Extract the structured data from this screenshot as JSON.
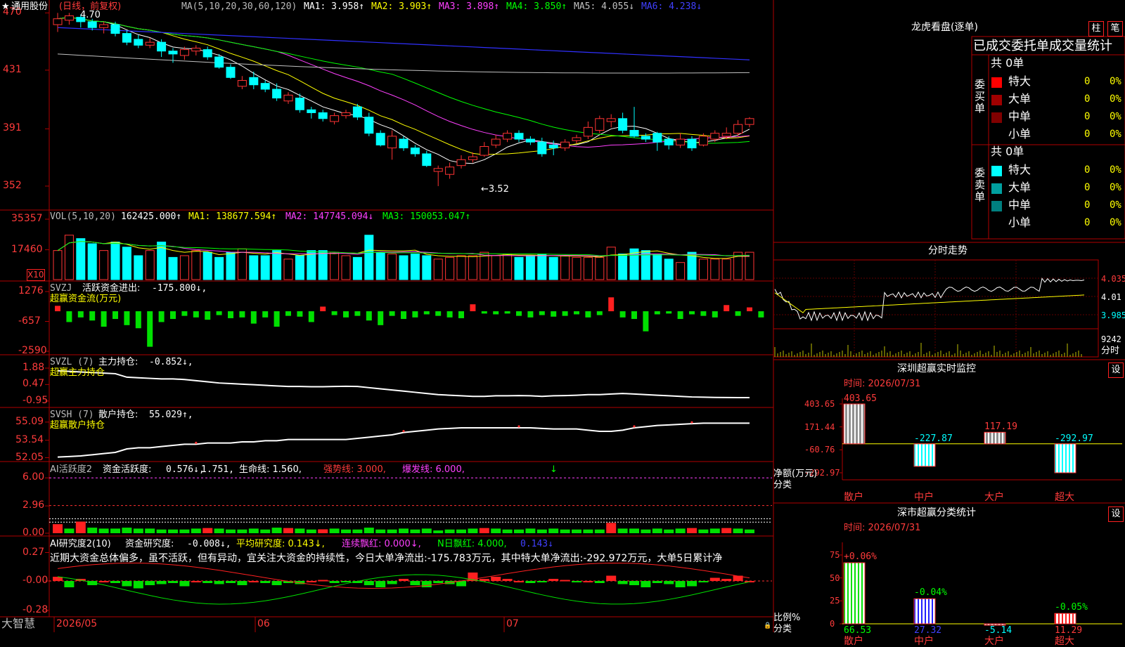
{
  "app": {
    "brand": "大智慧"
  },
  "kline": {
    "star": "★",
    "stock": "通用股份",
    "mode": "(日线，前复权)",
    "ma_head": "MA(5,10,20,30,60,120)",
    "ma": [
      {
        "label": "MA1: 3.958↑",
        "color": "#ffffff"
      },
      {
        "label": "MA2: 3.903↑",
        "color": "#ffff00"
      },
      {
        "label": "MA3: 3.898↑",
        "color": "#ff40ff"
      },
      {
        "label": "MA4: 3.850↑",
        "color": "#00ff00"
      },
      {
        "label": "MA5: 4.055↓",
        "color": "#c0c0c0"
      },
      {
        "label": "MA6: 4.238↓",
        "color": "#4040ff"
      }
    ],
    "yaxis": [
      "470",
      "431",
      "391",
      "352"
    ],
    "yrange": [
      3.4,
      4.74
    ],
    "high_label": "4.70",
    "low_label": "←3.52",
    "candles": [
      [
        4.62,
        4.66,
        4.7,
        4.57
      ],
      [
        4.65,
        4.68,
        4.7,
        4.62
      ],
      [
        4.67,
        4.64,
        4.69,
        4.6
      ],
      [
        4.64,
        4.6,
        4.66,
        4.58
      ],
      [
        4.6,
        4.62,
        4.64,
        4.56
      ],
      [
        4.62,
        4.56,
        4.64,
        4.54
      ],
      [
        4.56,
        4.5,
        4.58,
        4.48
      ],
      [
        4.52,
        4.48,
        4.55,
        4.46
      ],
      [
        4.48,
        4.5,
        4.53,
        4.46
      ],
      [
        4.5,
        4.44,
        4.52,
        4.4
      ],
      [
        4.44,
        4.42,
        4.46,
        4.36
      ],
      [
        4.41,
        4.45,
        4.47,
        4.38
      ],
      [
        4.44,
        4.46,
        4.48,
        4.41
      ],
      [
        4.45,
        4.4,
        4.47,
        4.38
      ],
      [
        4.4,
        4.33,
        4.42,
        4.32
      ],
      [
        4.33,
        4.26,
        4.35,
        4.25
      ],
      [
        4.2,
        4.24,
        4.27,
        4.18
      ],
      [
        4.26,
        4.21,
        4.3,
        4.18
      ],
      [
        4.22,
        4.18,
        4.24,
        4.16
      ],
      [
        4.18,
        4.12,
        4.22,
        4.1
      ],
      [
        4.1,
        4.14,
        4.16,
        4.08
      ],
      [
        4.12,
        4.04,
        4.15,
        4.02
      ],
      [
        4.04,
        4.02,
        4.06,
        3.98
      ],
      [
        4.02,
        3.98,
        4.04,
        3.96
      ],
      [
        3.96,
        4.0,
        4.02,
        3.94
      ],
      [
        4.0,
        4.02,
        4.04,
        3.98
      ],
      [
        4.06,
        3.99,
        4.08,
        3.97
      ],
      [
        3.99,
        3.88,
        4.02,
        3.86
      ],
      [
        3.88,
        3.8,
        3.9,
        3.79
      ],
      [
        3.78,
        3.86,
        3.9,
        3.7
      ],
      [
        3.84,
        3.78,
        3.86,
        3.76
      ],
      [
        3.78,
        3.74,
        3.8,
        3.72
      ],
      [
        3.74,
        3.66,
        3.76,
        3.65
      ],
      [
        3.62,
        3.64,
        3.66,
        3.52
      ],
      [
        3.6,
        3.65,
        3.68,
        3.57
      ],
      [
        3.66,
        3.7,
        3.73,
        3.64
      ],
      [
        3.7,
        3.72,
        3.75,
        3.68
      ],
      [
        3.73,
        3.79,
        3.82,
        3.72
      ],
      [
        3.8,
        3.84,
        3.87,
        3.78
      ],
      [
        3.84,
        3.88,
        3.9,
        3.82
      ],
      [
        3.88,
        3.84,
        3.9,
        3.82
      ],
      [
        3.84,
        3.82,
        3.86,
        3.8
      ],
      [
        3.82,
        3.74,
        3.85,
        3.72
      ],
      [
        3.8,
        3.78,
        3.83,
        3.73
      ],
      [
        3.78,
        3.82,
        3.84,
        3.76
      ],
      [
        3.83,
        3.85,
        3.87,
        3.81
      ],
      [
        3.86,
        3.92,
        3.96,
        3.84
      ],
      [
        3.9,
        3.98,
        4.0,
        3.88
      ],
      [
        3.96,
        3.98,
        4.01,
        3.92
      ],
      [
        3.98,
        3.9,
        4.02,
        3.88
      ],
      [
        3.9,
        3.86,
        4.06,
        3.85
      ],
      [
        3.86,
        3.84,
        3.88,
        3.82
      ],
      [
        3.88,
        3.82,
        3.89,
        3.76
      ],
      [
        3.84,
        3.8,
        3.86,
        3.77
      ],
      [
        3.8,
        3.84,
        3.88,
        3.78
      ],
      [
        3.84,
        3.78,
        3.86,
        3.76
      ],
      [
        3.8,
        3.86,
        3.88,
        3.79
      ],
      [
        3.84,
        3.88,
        3.9,
        3.82
      ],
      [
        3.86,
        3.88,
        3.92,
        3.84
      ],
      [
        3.88,
        3.94,
        3.97,
        3.86
      ],
      [
        3.94,
        3.98,
        3.99,
        3.92
      ]
    ]
  },
  "vol": {
    "head": "VOL(5,10,20)",
    "value": "162425.000↑",
    "ma": [
      {
        "label": "MA1: 138677.594↑",
        "color": "#ffff00"
      },
      {
        "label": "MA2: 147745.094↓",
        "color": "#ff40ff"
      },
      {
        "label": "MA3: 150053.047↑",
        "color": "#00ff00"
      }
    ],
    "yaxis": [
      "35357",
      "17460"
    ],
    "unit": "X10",
    "max": 35357,
    "bars": [
      17000,
      26000,
      24000,
      21000,
      17000,
      22000,
      19000,
      14000,
      17000,
      22000,
      13000,
      14000,
      17000,
      16000,
      13000,
      16000,
      18000,
      14000,
      14000,
      17000,
      12000,
      14000,
      17000,
      17000,
      16000,
      14000,
      13000,
      26000,
      16000,
      15000,
      14000,
      15000,
      14000,
      12000,
      13000,
      14000,
      14000,
      16000,
      14000,
      15000,
      13000,
      14000,
      15000,
      13000,
      14000,
      13000,
      13000,
      13000,
      19000,
      15000,
      18000,
      17000,
      15000,
      12000,
      10000,
      16000,
      12000,
      12000,
      12000,
      16000,
      16000
    ]
  },
  "svzj": {
    "head": "SVZJ",
    "title": "活跃资金进出:",
    "value": "-175.800↓,",
    "sub": "超赢资金流(万元)",
    "yaxis": [
      "1276",
      "-657",
      "-2590"
    ],
    "range": [
      -2590,
      1276
    ],
    "values": [
      350,
      -700,
      -400,
      -600,
      -1000,
      -500,
      -900,
      -1100,
      -2300,
      -700,
      -500,
      -300,
      -400,
      -550,
      -250,
      -450,
      -400,
      -800,
      -400,
      -1000,
      -300,
      -350,
      -700,
      300,
      -250,
      -400,
      -300,
      -600,
      -900,
      -300,
      -500,
      -400,
      -200,
      -300,
      -400,
      -450,
      450,
      -150,
      -200,
      -150,
      -300,
      -400,
      -250,
      -350,
      -300,
      -200,
      -400,
      -250,
      900,
      -400,
      -500,
      -1300,
      -200,
      -150,
      -500,
      -200,
      -300,
      -400,
      400,
      -300,
      250,
      -400
    ]
  },
  "svzl": {
    "head": "SVZL (7)",
    "title": "主力持仓:",
    "value": "-0.852↓,",
    "sub": "超赢主力持仓",
    "yaxis": [
      "1.88",
      "0.47",
      "-0.95"
    ],
    "range": [
      -1.2,
      2.0
    ],
    "values": [
      1.65,
      1.6,
      1.55,
      1.5,
      1.45,
      1.4,
      1.1,
      1.05,
      1.0,
      0.95,
      0.95,
      0.9,
      0.8,
      0.7,
      0.6,
      0.55,
      0.5,
      0.45,
      0.4,
      0.35,
      0.3,
      0.3,
      0.28,
      0.28,
      0.3,
      0.32,
      0.3,
      0.2,
      0.1,
      0.0,
      -0.1,
      -0.2,
      -0.3,
      -0.4,
      -0.45,
      -0.5,
      -0.55,
      -0.55,
      -0.5,
      -0.5,
      -0.48,
      -0.5,
      -0.55,
      -0.5,
      -0.48,
      -0.45,
      -0.4,
      -0.4,
      -0.35,
      -0.3,
      -0.35,
      -0.4,
      -0.45,
      -0.5,
      -0.55,
      -0.6,
      -0.62,
      -0.64,
      -0.65,
      -0.66,
      -0.66
    ]
  },
  "svsh": {
    "head": "SVSH (7)",
    "title": "散户持仓:",
    "value": "55.029↑,",
    "sub": "超赢散户持仓",
    "yaxis": [
      "55.09",
      "53.54",
      "52.05"
    ],
    "range": [
      51.9,
      55.5
    ],
    "values": [
      52.1,
      52.15,
      52.2,
      52.3,
      52.4,
      52.5,
      52.8,
      52.9,
      52.9,
      53.0,
      53.1,
      53.2,
      53.2,
      53.3,
      53.3,
      53.3,
      53.4,
      53.4,
      53.5,
      53.5,
      53.6,
      53.6,
      53.6,
      53.6,
      53.6,
      53.6,
      53.7,
      53.8,
      53.9,
      54.0,
      54.2,
      54.3,
      54.4,
      54.5,
      54.55,
      54.6,
      54.6,
      54.6,
      54.6,
      54.6,
      54.6,
      54.6,
      54.55,
      54.5,
      54.5,
      54.5,
      54.4,
      54.3,
      54.3,
      54.4,
      54.6,
      54.7,
      54.8,
      54.85,
      54.9,
      54.95,
      55.0,
      55.0,
      55.0,
      55.0,
      55.0
    ]
  },
  "ai2": {
    "head": "AI活跃度2",
    "title": "资金活跃度:",
    "v1": "0.576↓,",
    "v2": "1.751,",
    "life": "生命线: 1.560,",
    "strong": "强势线: 3.000,",
    "burst": "爆发线: 6.000,",
    "mark": "↓",
    "yaxis": [
      "6.00",
      "2.96",
      "0.00"
    ],
    "range": [
      0,
      6.4
    ],
    "values": [
      0.7,
      0.5,
      0.9,
      0.6,
      0.5,
      0.5,
      0.6,
      0.5,
      0.5,
      0.4,
      0.4,
      0.4,
      0.5,
      0.4,
      0.5,
      0.4,
      0.4,
      0.5,
      0.4,
      0.6,
      0.4,
      0.5,
      0.4,
      0.3,
      0.5,
      0.4,
      0.4,
      0.6,
      0.4,
      0.4,
      0.5,
      0.4,
      0.5,
      0.3,
      0.4,
      0.4,
      0.5,
      0.4,
      0.5,
      0.4,
      0.4,
      0.5,
      0.4,
      0.5,
      0.4,
      0.4,
      0.4,
      0.4,
      0.8,
      0.5,
      0.5,
      0.4,
      0.5,
      0.4,
      0.5,
      0.4,
      0.4,
      0.5,
      0.4,
      0.5,
      0.4
    ],
    "reds": [
      0,
      2,
      13,
      20,
      23,
      37,
      48,
      55,
      58
    ]
  },
  "ai_research": {
    "head": "AI研究度2(10)",
    "title": "资金研究度:",
    "v1": "-0.008↓,",
    "avg": "平均研究度: 0.143↓,",
    "red": "连续飘红: 0.000↓,",
    "nred": "N日飘红: 4.000,",
    "v5": "0.143↓",
    "note": "近期大资金总体偏多，虽不活跃，但有异动，宜关注大资金的持续性，今日大单净流出:-175.783万元，其中特大单净流出:-292.972万元，大单5日累计净",
    "yaxis": [
      "0.27",
      "-0.00",
      "-0.28"
    ],
    "range": [
      -0.3,
      0.3
    ],
    "values": [
      0.04,
      -0.06,
      0.02,
      -0.04,
      0.0,
      -0.02,
      -0.05,
      -0.07,
      -0.04,
      -0.03,
      -0.02,
      -0.05,
      0.0,
      -0.02,
      -0.03,
      -0.02,
      -0.04,
      0.0,
      -0.02,
      -0.04,
      -0.02,
      -0.03,
      0.0,
      0.01,
      -0.02,
      -0.01,
      -0.02,
      -0.04,
      -0.06,
      -0.03,
      0.02,
      -0.04,
      -0.06,
      -0.02,
      -0.03,
      -0.05,
      0.08,
      0.02,
      0.04,
      0.02,
      0.0,
      -0.02,
      -0.01,
      0.02,
      0.01,
      -0.01,
      0.0,
      -0.02,
      0.05,
      -0.03,
      -0.04,
      -0.06,
      -0.02,
      -0.03,
      -0.06,
      -0.05,
      -0.01,
      0.03,
      0.02,
      0.05,
      0.0
    ]
  },
  "xaxis": [
    "2026/05",
    "06",
    "07"
  ],
  "right": {
    "longhu": {
      "title": "龙虎看盘(逐单)",
      "btn1": "柱",
      "btn2": "笔",
      "header": "已成交委托单成交量统计",
      "buy": {
        "count": "共 0单",
        "label": "委买单",
        "rows": [
          {
            "name": "特大",
            "v": "0",
            "p": "0%",
            "c": "#ff0000"
          },
          {
            "name": "大单",
            "v": "0",
            "p": "0%",
            "c": "#a00000"
          },
          {
            "name": "中单",
            "v": "0",
            "p": "0%",
            "c": "#800000"
          },
          {
            "name": "小单",
            "v": "0",
            "p": "0%",
            "c": "#000000"
          }
        ]
      },
      "sell": {
        "count": "共 0单",
        "label": "委卖单",
        "rows": [
          {
            "name": "特大",
            "v": "0",
            "p": "0%",
            "c": "#00ffff"
          },
          {
            "name": "大单",
            "v": "0",
            "p": "0%",
            "c": "#00a0a0"
          },
          {
            "name": "中单",
            "v": "0",
            "p": "0%",
            "c": "#008080"
          },
          {
            "name": "小单",
            "v": "0",
            "p": "0%",
            "c": "#000000"
          }
        ]
      }
    },
    "intraday": {
      "title": "分时走势",
      "prices": [
        "4.035",
        "4.01",
        "3.985"
      ],
      "vol": "9242",
      "unit": "分时"
    },
    "monitor": {
      "title": "深圳超赢实时监控",
      "btn": "设",
      "time": "时间: 2026/07/31",
      "yaxis": [
        "403.65",
        "171.44",
        "-60.76",
        "-292.97"
      ],
      "ylabel": "净额(万元)",
      "xlabel": "分类",
      "cats": [
        {
          "name": "散户",
          "v": 403.65,
          "label": "403.65"
        },
        {
          "name": "中户",
          "v": -227.87,
          "label": "-227.87"
        },
        {
          "name": "大户",
          "v": 117.19,
          "label": "117.19"
        },
        {
          "name": "超大",
          "v": -292.97,
          "label": "-292.97"
        }
      ],
      "range": [
        -292.97,
        403.65
      ]
    },
    "stats": {
      "title": "深市超赢分类统计",
      "btn": "设",
      "time": "时间: 2026/07/31",
      "yaxis": [
        "75",
        "50",
        "25",
        "0"
      ],
      "ylabel": "比例%",
      "xlabel": "分类",
      "cats": [
        {
          "name": "散户",
          "v": 66.53,
          "label": "66.53",
          "top": "+0.06%"
        },
        {
          "name": "中户",
          "v": 27.32,
          "label": "27.32",
          "top": "-0.04%"
        },
        {
          "name": "大户",
          "v": -5.14,
          "label": "-5.14",
          "top": ""
        },
        {
          "name": "超大",
          "v": 11.29,
          "label": "11.29",
          "top": "-0.05%"
        }
      ]
    }
  },
  "colors": {
    "up": "#ff3333",
    "down": "#00ffff",
    "grid": "#b00000",
    "green": "#00e000"
  }
}
